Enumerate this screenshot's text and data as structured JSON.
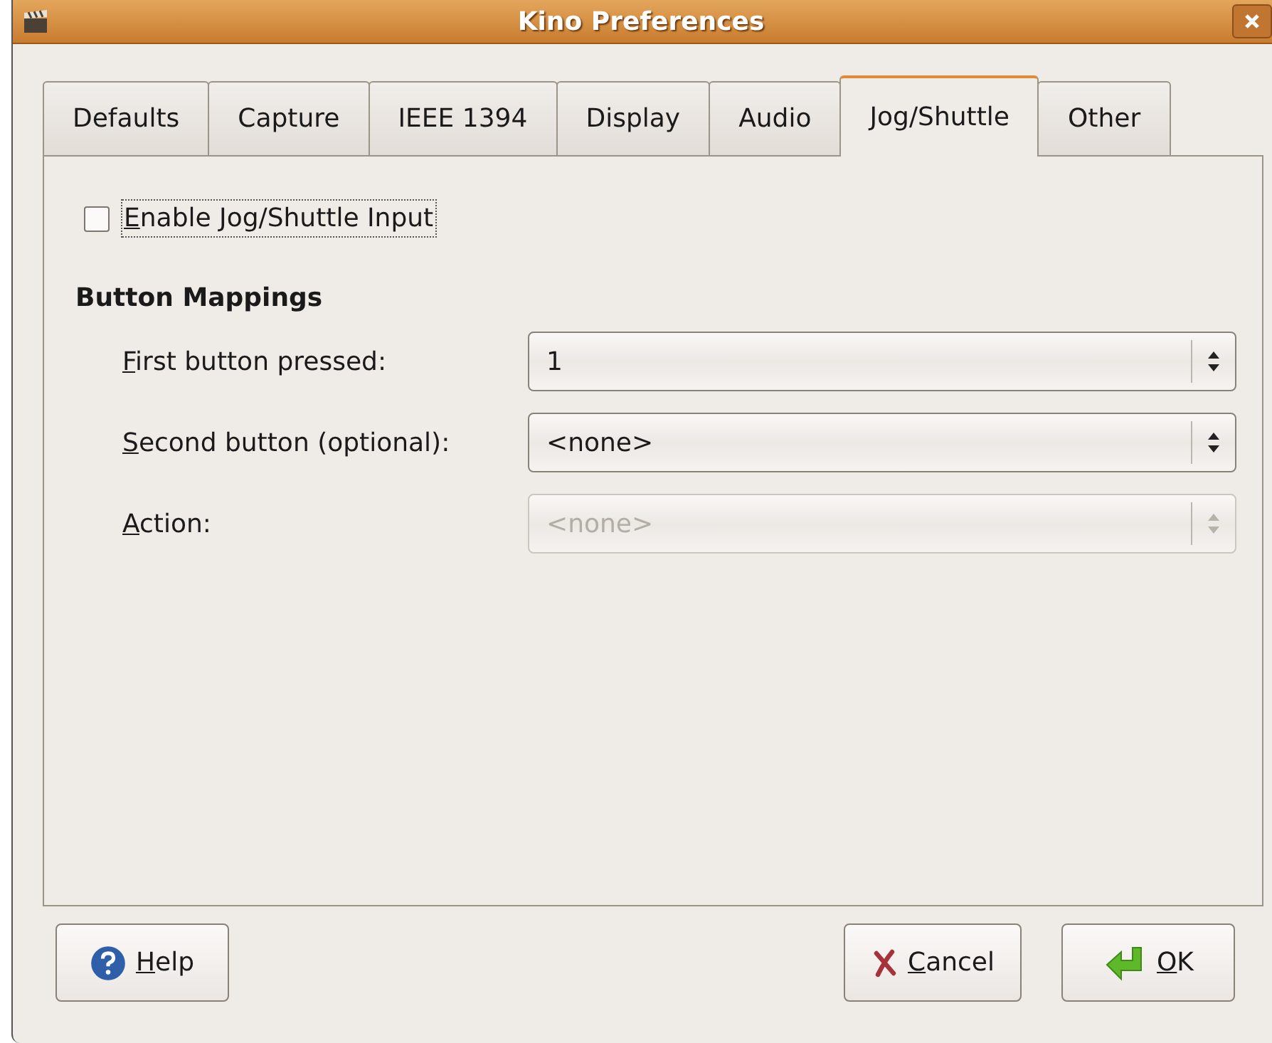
{
  "window": {
    "title": "Kino Preferences"
  },
  "tabs": [
    {
      "label": "Defaults",
      "selected": false
    },
    {
      "label": "Capture",
      "selected": false
    },
    {
      "label": "IEEE 1394",
      "selected": false
    },
    {
      "label": "Display",
      "selected": false
    },
    {
      "label": "Audio",
      "selected": false
    },
    {
      "label": "Jog/Shuttle",
      "selected": true
    },
    {
      "label": "Other",
      "selected": false
    }
  ],
  "enable_checkbox": {
    "label": "Enable Jog/Shuttle Input",
    "checked": false,
    "focused": true
  },
  "section_title": "Button Mappings",
  "mappings": [
    {
      "label": "First button pressed:",
      "value": "1",
      "disabled": false
    },
    {
      "label": "Second button (optional):",
      "value": "<none>",
      "disabled": false
    },
    {
      "label": "Action:",
      "value": "<none>",
      "disabled": true
    }
  ],
  "buttons": [
    {
      "label": "Help",
      "kind": "help"
    },
    {
      "label": "Cancel",
      "kind": "cancel"
    },
    {
      "label": "OK",
      "kind": "ok"
    }
  ]
}
